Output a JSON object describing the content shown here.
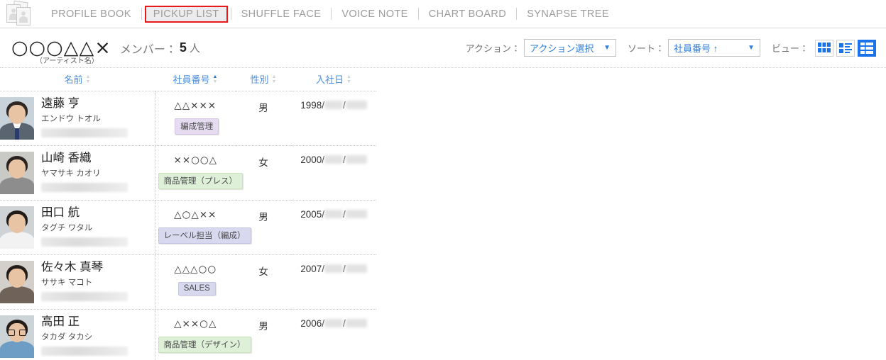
{
  "nav": {
    "logo_icon": "profile-cards-icon",
    "items": [
      {
        "label": "PROFILE BOOK",
        "active": false
      },
      {
        "label": "PICKUP LIST",
        "active": true
      },
      {
        "label": "SHUFFLE FACE",
        "active": false
      },
      {
        "label": "VOICE NOTE",
        "active": false
      },
      {
        "label": "CHART BOARD",
        "active": false
      },
      {
        "label": "SYNAPSE TREE",
        "active": false
      }
    ],
    "active_highlight_color": "#e8171c"
  },
  "header": {
    "artist_name": "○○○△△×",
    "artist_name_note": "（アーティスト名）",
    "member_label": "メンバー：",
    "member_count": "5",
    "member_unit": "人"
  },
  "controls": {
    "action_label": "アクション：",
    "action_value": "アクション選択",
    "sort_label": "ソート：",
    "sort_value": "社員番号 ↑",
    "view_label": "ビュー：",
    "caret": "▼",
    "views": [
      {
        "name": "grid-view",
        "active": false
      },
      {
        "name": "list-view",
        "active": false
      },
      {
        "name": "table-view",
        "active": true
      }
    ],
    "accent_color": "#1a73e8",
    "link_color": "#2f7ddb"
  },
  "table": {
    "columns": [
      {
        "label": "名前",
        "sort": "none"
      },
      {
        "label": "社員番号",
        "sort": "asc"
      },
      {
        "label": "性別",
        "sort": "none"
      },
      {
        "label": "入社日",
        "sort": "none"
      }
    ],
    "arrow_up": "▲",
    "arrow_down": "▼",
    "rows": [
      {
        "name": "遠藤 亨",
        "kana": "エンドウ トオル",
        "code": "△△×××",
        "gender": "男",
        "year": "1998/",
        "date_sep": "/",
        "tag": "編成管理",
        "tag_color": "purple"
      },
      {
        "name": "山崎 香織",
        "kana": "ヤマサキ カオリ",
        "code": "××○○△",
        "gender": "女",
        "year": "2000/",
        "date_sep": "/",
        "tag": "商品管理（プレス）",
        "tag_color": "green"
      },
      {
        "name": "田口 航",
        "kana": "タグチ ワタル",
        "code": "△○△××",
        "gender": "男",
        "year": "2005/",
        "date_sep": "/",
        "tag": "レーベル担当（編成）",
        "tag_color": "lav"
      },
      {
        "name": "佐々木 真琴",
        "kana": "ササキ マコト",
        "code": "△△△○○",
        "gender": "女",
        "year": "2007/",
        "date_sep": "/",
        "tag": "SALES",
        "tag_color": "lav"
      },
      {
        "name": "高田 正",
        "kana": "タカダ タカシ",
        "code": "△××○△",
        "gender": "男",
        "year": "2006/",
        "date_sep": "/",
        "tag": "商品管理（デザイン）",
        "tag_color": "green"
      }
    ]
  }
}
